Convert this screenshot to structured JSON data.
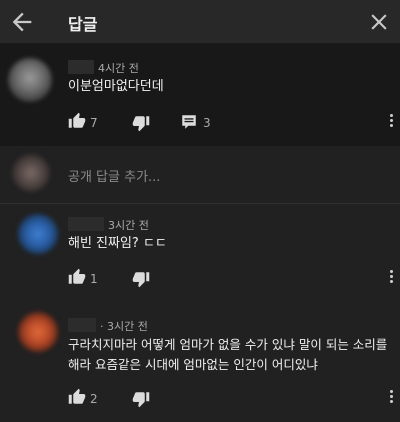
{
  "header": {
    "title": "답글"
  },
  "parent_comment": {
    "time": "4시간 전",
    "text": "이분엄마없다던데",
    "likes": "7",
    "replies": "3"
  },
  "add_reply": {
    "placeholder": "공개 답글 추가..."
  },
  "replies": [
    {
      "time": "3시간 전",
      "text_lines": [
        "해빈 진짜임? ㄷㄷ"
      ],
      "likes": "1"
    },
    {
      "time": "· 3시간 전",
      "text_lines": [
        "구라치지마라 어떻게 엄마가 없을 수가 있냐 말이 되는 소리를",
        "해라 요즘같은 시대에 엄마없는 인간이 어디있냐"
      ],
      "likes": "2"
    }
  ],
  "colors": {
    "background": "#212121",
    "header": "#282828",
    "parent_background": "#181818",
    "secondary_text": "#aaaaaa"
  }
}
